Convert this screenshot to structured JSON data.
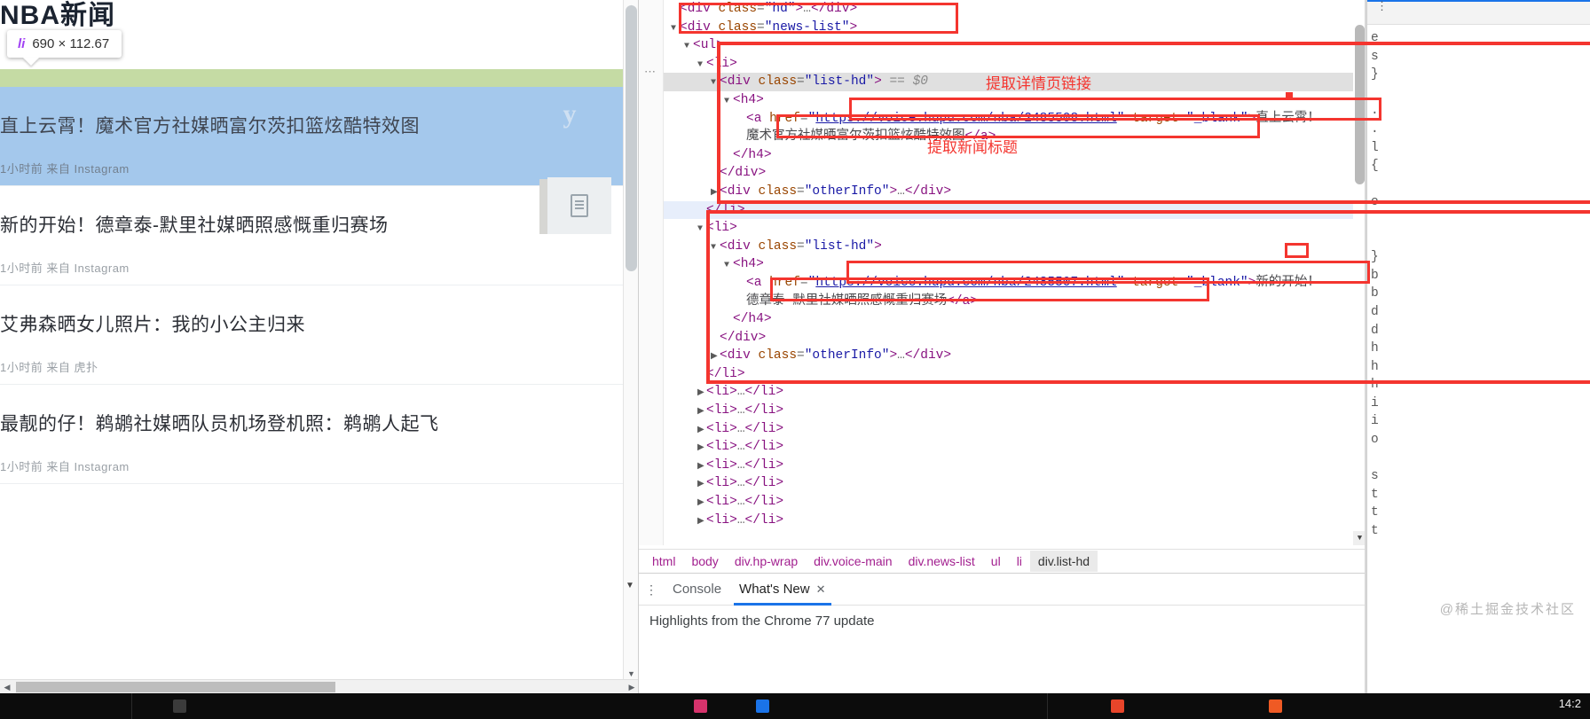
{
  "page": {
    "site_title": "NBA新闻",
    "inspector_tooltip": {
      "tag": "li",
      "dims": "690 × 112.67"
    },
    "news_items": [
      {
        "title": "直上云霄！魔术官方社媒晒富尔茨扣篮炫酷特效图",
        "meta": "1小时前 来自 Instagram",
        "highlighted": true
      },
      {
        "title": "新的开始！德章泰-默里社媒晒照感慨重归赛场",
        "meta": "1小时前 来自 Instagram",
        "highlighted": false
      },
      {
        "title": "艾弗森晒女儿照片：我的小公主归来",
        "meta": "1小时前 来自 虎扑",
        "highlighted": false
      },
      {
        "title": "最靓的仔！鹈鹕社媒晒队员机场登机照：鹈鹕人起飞",
        "meta": "1小时前 来自 Instagram",
        "highlighted": false
      }
    ],
    "sns_badge": "y"
  },
  "devtools": {
    "dom_lines": [
      {
        "indent": 0,
        "twisty": "n",
        "html": "<span class=\"punc\">&lt;</span><span class=\"tagn\">div</span> <span class=\"attn\">class</span>=<span class=\"attv\">\"hd\"</span><span class=\"punc\">&gt;</span>…<span class=\"punc\">&lt;/</span><span class=\"tagn\">div</span><span class=\"punc\">&gt;</span>",
        "state": ""
      },
      {
        "indent": 0,
        "twisty": "d",
        "html": "<span class=\"punc\">&lt;</span><span class=\"tagn\">div</span> <span class=\"attn\">class</span>=<span class=\"attv\">\"news-list\"</span><span class=\"punc\">&gt;</span>",
        "state": ""
      },
      {
        "indent": 1,
        "twisty": "d",
        "html": "<span class=\"punc\">&lt;</span><span class=\"tagn\">ul</span><span class=\"punc\">&gt;</span>",
        "state": ""
      },
      {
        "indent": 2,
        "twisty": "d",
        "html": "<span class=\"punc\">&lt;</span><span class=\"tagn\">li</span><span class=\"punc\">&gt;</span>",
        "state": ""
      },
      {
        "indent": 3,
        "twisty": "d",
        "html": "<span class=\"punc\">&lt;</span><span class=\"tagn\">div</span> <span class=\"attn\">class</span>=<span class=\"attv\">\"list-hd\"</span><span class=\"punc\">&gt;</span> <span class=\"dollar\">== $0</span>",
        "state": "hov"
      },
      {
        "indent": 4,
        "twisty": "d",
        "html": "<span class=\"punc\">&lt;</span><span class=\"tagn\">h4</span><span class=\"punc\">&gt;</span>",
        "state": ""
      },
      {
        "indent": 5,
        "twisty": "n",
        "html": "<span class=\"punc\">&lt;</span><span class=\"tagn\">a</span> <span class=\"attn\">href</span>=<span class=\"attv\">\"</span><span class=\"link\">https://voice.hupu.com/nba/2485508.html</span><span class=\"attv\">\"</span> <span class=\"attn\">target</span>=<span class=\"attv\">\"_blank\"</span><span class=\"punc\">&gt;</span><span class=\"txt\">直上云霄！</span>",
        "state": ""
      },
      {
        "indent": 5,
        "twisty": "n",
        "html": "<span class=\"txt\">魔术官方社媒晒富尔茨扣篮炫酷特效图</span><span class=\"punc\">&lt;/</span><span class=\"tagn\">a</span><span class=\"punc\">&gt;</span>",
        "state": ""
      },
      {
        "indent": 4,
        "twisty": "n",
        "html": "<span class=\"punc\">&lt;/</span><span class=\"tagn\">h4</span><span class=\"punc\">&gt;</span>",
        "state": ""
      },
      {
        "indent": 3,
        "twisty": "n",
        "html": "<span class=\"punc\">&lt;/</span><span class=\"tagn\">div</span><span class=\"punc\">&gt;</span>",
        "state": ""
      },
      {
        "indent": 3,
        "twisty": "r",
        "html": "<span class=\"punc\">&lt;</span><span class=\"tagn\">div</span> <span class=\"attn\">class</span>=<span class=\"attv\">\"otherInfo\"</span><span class=\"punc\">&gt;</span>…<span class=\"punc\">&lt;/</span><span class=\"tagn\">div</span><span class=\"punc\">&gt;</span>",
        "state": ""
      },
      {
        "indent": 2,
        "twisty": "n",
        "html": "<span class=\"punc\">&lt;/</span><span class=\"tagn\">li</span><span class=\"punc\">&gt;</span>",
        "state": "sel"
      },
      {
        "indent": 2,
        "twisty": "d",
        "html": "<span class=\"punc\">&lt;</span><span class=\"tagn\">li</span><span class=\"punc\">&gt;</span>",
        "state": ""
      },
      {
        "indent": 3,
        "twisty": "d",
        "html": "<span class=\"punc\">&lt;</span><span class=\"tagn\">div</span> <span class=\"attn\">class</span>=<span class=\"attv\">\"list-hd\"</span><span class=\"punc\">&gt;</span>",
        "state": ""
      },
      {
        "indent": 4,
        "twisty": "d",
        "html": "<span class=\"punc\">&lt;</span><span class=\"tagn\">h4</span><span class=\"punc\">&gt;</span>",
        "state": ""
      },
      {
        "indent": 5,
        "twisty": "n",
        "html": "<span class=\"punc\">&lt;</span><span class=\"tagn\">a</span> <span class=\"attn\">href</span>=<span class=\"attv\">\"</span><span class=\"link\">https://voice.hupu.com/nba/2485507.html</span><span class=\"attv\">\"</span> <span class=\"attn\">target</span>=<span class=\"attv\">\"_blank\"</span><span class=\"punc\">&gt;</span><span class=\"txt\">新的开始！</span>",
        "state": ""
      },
      {
        "indent": 5,
        "twisty": "n",
        "html": "<span class=\"txt\">德章泰-默里社媒晒照感慨重归赛场</span><span class=\"punc\">&lt;/</span><span class=\"tagn\">a</span><span class=\"punc\">&gt;</span>",
        "state": ""
      },
      {
        "indent": 4,
        "twisty": "n",
        "html": "<span class=\"punc\">&lt;/</span><span class=\"tagn\">h4</span><span class=\"punc\">&gt;</span>",
        "state": ""
      },
      {
        "indent": 3,
        "twisty": "n",
        "html": "<span class=\"punc\">&lt;/</span><span class=\"tagn\">div</span><span class=\"punc\">&gt;</span>",
        "state": ""
      },
      {
        "indent": 3,
        "twisty": "r",
        "html": "<span class=\"punc\">&lt;</span><span class=\"tagn\">div</span> <span class=\"attn\">class</span>=<span class=\"attv\">\"otherInfo\"</span><span class=\"punc\">&gt;</span>…<span class=\"punc\">&lt;/</span><span class=\"tagn\">div</span><span class=\"punc\">&gt;</span>",
        "state": ""
      },
      {
        "indent": 2,
        "twisty": "n",
        "html": "<span class=\"punc\">&lt;/</span><span class=\"tagn\">li</span><span class=\"punc\">&gt;</span>",
        "state": ""
      },
      {
        "indent": 2,
        "twisty": "r",
        "html": "<span class=\"punc\">&lt;</span><span class=\"tagn\">li</span><span class=\"punc\">&gt;</span>…<span class=\"punc\">&lt;/</span><span class=\"tagn\">li</span><span class=\"punc\">&gt;</span>",
        "state": ""
      },
      {
        "indent": 2,
        "twisty": "r",
        "html": "<span class=\"punc\">&lt;</span><span class=\"tagn\">li</span><span class=\"punc\">&gt;</span>…<span class=\"punc\">&lt;/</span><span class=\"tagn\">li</span><span class=\"punc\">&gt;</span>",
        "state": ""
      },
      {
        "indent": 2,
        "twisty": "r",
        "html": "<span class=\"punc\">&lt;</span><span class=\"tagn\">li</span><span class=\"punc\">&gt;</span>…<span class=\"punc\">&lt;/</span><span class=\"tagn\">li</span><span class=\"punc\">&gt;</span>",
        "state": ""
      },
      {
        "indent": 2,
        "twisty": "r",
        "html": "<span class=\"punc\">&lt;</span><span class=\"tagn\">li</span><span class=\"punc\">&gt;</span>…<span class=\"punc\">&lt;/</span><span class=\"tagn\">li</span><span class=\"punc\">&gt;</span>",
        "state": ""
      },
      {
        "indent": 2,
        "twisty": "r",
        "html": "<span class=\"punc\">&lt;</span><span class=\"tagn\">li</span><span class=\"punc\">&gt;</span>…<span class=\"punc\">&lt;/</span><span class=\"tagn\">li</span><span class=\"punc\">&gt;</span>",
        "state": ""
      },
      {
        "indent": 2,
        "twisty": "r",
        "html": "<span class=\"punc\">&lt;</span><span class=\"tagn\">li</span><span class=\"punc\">&gt;</span>…<span class=\"punc\">&lt;/</span><span class=\"tagn\">li</span><span class=\"punc\">&gt;</span>",
        "state": ""
      },
      {
        "indent": 2,
        "twisty": "r",
        "html": "<span class=\"punc\">&lt;</span><span class=\"tagn\">li</span><span class=\"punc\">&gt;</span>…<span class=\"punc\">&lt;/</span><span class=\"tagn\">li</span><span class=\"punc\">&gt;</span>",
        "state": ""
      },
      {
        "indent": 2,
        "twisty": "r",
        "html": "<span class=\"punc\">&lt;</span><span class=\"tagn\">li</span><span class=\"punc\">&gt;</span>…<span class=\"punc\">&lt;/</span><span class=\"tagn\">li</span><span class=\"punc\">&gt;</span>",
        "state": ""
      }
    ],
    "annotations": [
      {
        "text": "提取详情页链接"
      },
      {
        "text": "提取新闻标题"
      }
    ],
    "breadcrumbs": [
      {
        "label": "html",
        "active": false
      },
      {
        "label": "body",
        "active": false
      },
      {
        "label": "div.hp-wrap",
        "active": false
      },
      {
        "label": "div.voice-main",
        "active": false
      },
      {
        "label": "div.news-list",
        "active": false
      },
      {
        "label": "ul",
        "active": false
      },
      {
        "label": "li",
        "active": false
      },
      {
        "label": "div.list-hd",
        "active": true
      }
    ],
    "drawer": {
      "tabs": [
        {
          "label": "Console",
          "active": false,
          "closable": false
        },
        {
          "label": "What's New",
          "active": true,
          "closable": true
        }
      ],
      "close_glyph": "✕",
      "body_text": "Highlights from the Chrome 77 update"
    },
    "styles_pane_lines": [
      "e",
      "s",
      "}",
      "",
      ".",
      ".",
      "l",
      "{",
      "",
      "o",
      "",
      "",
      "}",
      "b",
      "b",
      "d",
      "d",
      "h",
      "h",
      "h",
      "i",
      "i",
      "o",
      "",
      "s",
      "t",
      "t",
      "t"
    ]
  },
  "watermark": "@稀土掘金技术社区",
  "taskbar": {
    "clock": "14:2"
  },
  "colors": {
    "annotation_red": "#f4352f",
    "highlight_blue": "#a4c8ec",
    "margin_green": "#c5dba4",
    "padding_gray": "#d6d6d3",
    "devtools_accent": "#1a73e8",
    "tag_purple": "#881280",
    "attr_orange": "#994500",
    "value_blue": "#1a1aa6"
  }
}
